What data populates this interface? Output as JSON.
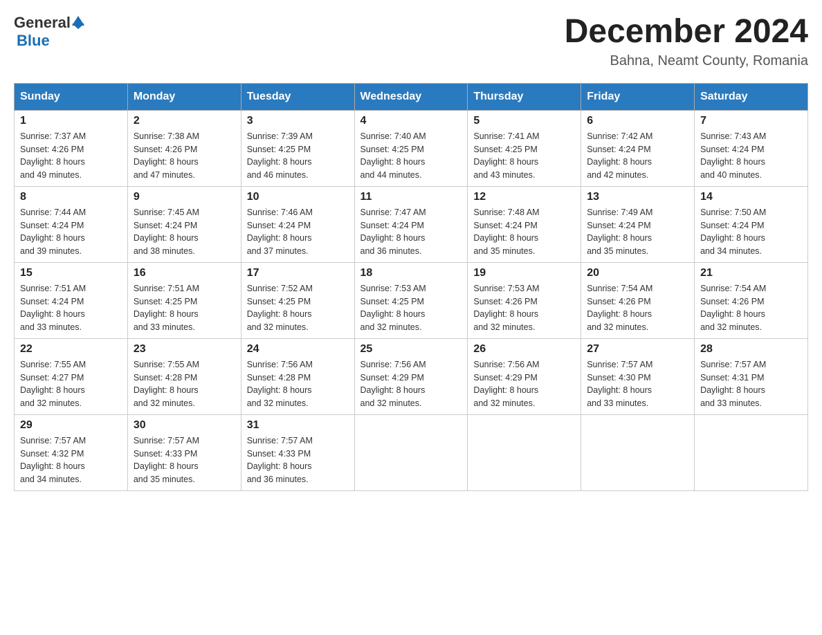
{
  "header": {
    "logo_general": "General",
    "logo_blue": "Blue",
    "month_title": "December 2024",
    "location": "Bahna, Neamt County, Romania"
  },
  "days_of_week": [
    "Sunday",
    "Monday",
    "Tuesday",
    "Wednesday",
    "Thursday",
    "Friday",
    "Saturday"
  ],
  "weeks": [
    [
      {
        "day": "1",
        "sunrise": "7:37 AM",
        "sunset": "4:26 PM",
        "daylight": "8 hours and 49 minutes."
      },
      {
        "day": "2",
        "sunrise": "7:38 AM",
        "sunset": "4:26 PM",
        "daylight": "8 hours and 47 minutes."
      },
      {
        "day": "3",
        "sunrise": "7:39 AM",
        "sunset": "4:25 PM",
        "daylight": "8 hours and 46 minutes."
      },
      {
        "day": "4",
        "sunrise": "7:40 AM",
        "sunset": "4:25 PM",
        "daylight": "8 hours and 44 minutes."
      },
      {
        "day": "5",
        "sunrise": "7:41 AM",
        "sunset": "4:25 PM",
        "daylight": "8 hours and 43 minutes."
      },
      {
        "day": "6",
        "sunrise": "7:42 AM",
        "sunset": "4:24 PM",
        "daylight": "8 hours and 42 minutes."
      },
      {
        "day": "7",
        "sunrise": "7:43 AM",
        "sunset": "4:24 PM",
        "daylight": "8 hours and 40 minutes."
      }
    ],
    [
      {
        "day": "8",
        "sunrise": "7:44 AM",
        "sunset": "4:24 PM",
        "daylight": "8 hours and 39 minutes."
      },
      {
        "day": "9",
        "sunrise": "7:45 AM",
        "sunset": "4:24 PM",
        "daylight": "8 hours and 38 minutes."
      },
      {
        "day": "10",
        "sunrise": "7:46 AM",
        "sunset": "4:24 PM",
        "daylight": "8 hours and 37 minutes."
      },
      {
        "day": "11",
        "sunrise": "7:47 AM",
        "sunset": "4:24 PM",
        "daylight": "8 hours and 36 minutes."
      },
      {
        "day": "12",
        "sunrise": "7:48 AM",
        "sunset": "4:24 PM",
        "daylight": "8 hours and 35 minutes."
      },
      {
        "day": "13",
        "sunrise": "7:49 AM",
        "sunset": "4:24 PM",
        "daylight": "8 hours and 35 minutes."
      },
      {
        "day": "14",
        "sunrise": "7:50 AM",
        "sunset": "4:24 PM",
        "daylight": "8 hours and 34 minutes."
      }
    ],
    [
      {
        "day": "15",
        "sunrise": "7:51 AM",
        "sunset": "4:24 PM",
        "daylight": "8 hours and 33 minutes."
      },
      {
        "day": "16",
        "sunrise": "7:51 AM",
        "sunset": "4:25 PM",
        "daylight": "8 hours and 33 minutes."
      },
      {
        "day": "17",
        "sunrise": "7:52 AM",
        "sunset": "4:25 PM",
        "daylight": "8 hours and 32 minutes."
      },
      {
        "day": "18",
        "sunrise": "7:53 AM",
        "sunset": "4:25 PM",
        "daylight": "8 hours and 32 minutes."
      },
      {
        "day": "19",
        "sunrise": "7:53 AM",
        "sunset": "4:26 PM",
        "daylight": "8 hours and 32 minutes."
      },
      {
        "day": "20",
        "sunrise": "7:54 AM",
        "sunset": "4:26 PM",
        "daylight": "8 hours and 32 minutes."
      },
      {
        "day": "21",
        "sunrise": "7:54 AM",
        "sunset": "4:26 PM",
        "daylight": "8 hours and 32 minutes."
      }
    ],
    [
      {
        "day": "22",
        "sunrise": "7:55 AM",
        "sunset": "4:27 PM",
        "daylight": "8 hours and 32 minutes."
      },
      {
        "day": "23",
        "sunrise": "7:55 AM",
        "sunset": "4:28 PM",
        "daylight": "8 hours and 32 minutes."
      },
      {
        "day": "24",
        "sunrise": "7:56 AM",
        "sunset": "4:28 PM",
        "daylight": "8 hours and 32 minutes."
      },
      {
        "day": "25",
        "sunrise": "7:56 AM",
        "sunset": "4:29 PM",
        "daylight": "8 hours and 32 minutes."
      },
      {
        "day": "26",
        "sunrise": "7:56 AM",
        "sunset": "4:29 PM",
        "daylight": "8 hours and 32 minutes."
      },
      {
        "day": "27",
        "sunrise": "7:57 AM",
        "sunset": "4:30 PM",
        "daylight": "8 hours and 33 minutes."
      },
      {
        "day": "28",
        "sunrise": "7:57 AM",
        "sunset": "4:31 PM",
        "daylight": "8 hours and 33 minutes."
      }
    ],
    [
      {
        "day": "29",
        "sunrise": "7:57 AM",
        "sunset": "4:32 PM",
        "daylight": "8 hours and 34 minutes."
      },
      {
        "day": "30",
        "sunrise": "7:57 AM",
        "sunset": "4:33 PM",
        "daylight": "8 hours and 35 minutes."
      },
      {
        "day": "31",
        "sunrise": "7:57 AM",
        "sunset": "4:33 PM",
        "daylight": "8 hours and 36 minutes."
      },
      null,
      null,
      null,
      null
    ]
  ],
  "labels": {
    "sunrise": "Sunrise:",
    "sunset": "Sunset:",
    "daylight": "Daylight:"
  }
}
